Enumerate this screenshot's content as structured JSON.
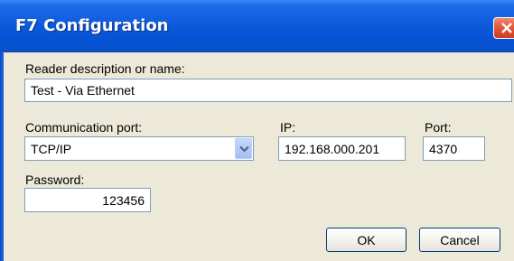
{
  "window": {
    "title": "F7 Configuration"
  },
  "icons": {
    "close": "close-icon",
    "dropdown": "chevron-down-icon"
  },
  "colors": {
    "title_bar": "#0a58da",
    "close_button": "#e2593a",
    "dialog_bg": "#ece9d8"
  },
  "form": {
    "description_label": "Reader description or name:",
    "description_value": "Test - Via Ethernet",
    "port_label": "Communication port:",
    "port_value": "TCP/IP",
    "ip_label": "IP:",
    "ip_value": "192.168.000.201",
    "tcp_port_label": "Port:",
    "tcp_port_value": "4370",
    "password_label": "Password:",
    "password_value": "123456"
  },
  "buttons": {
    "ok": "OK",
    "cancel": "Cancel"
  }
}
